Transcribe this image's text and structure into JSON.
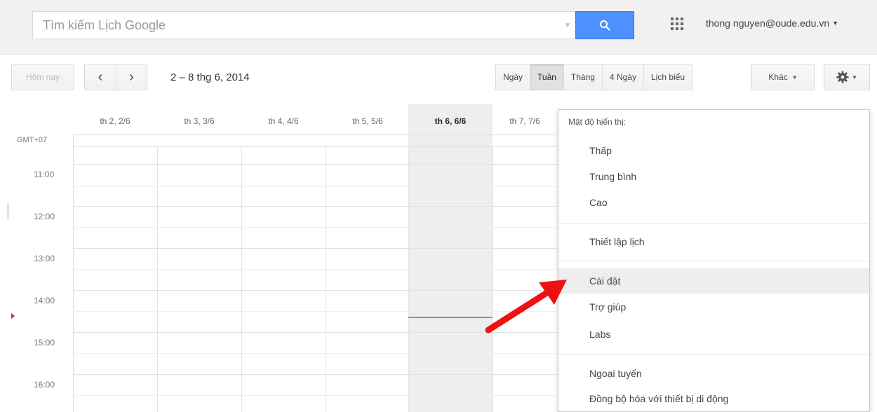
{
  "header": {
    "search_placeholder": "Tìm kiếm Lịch Google",
    "account": "thong nguyen@oude.edu.vn",
    "accent_color": "#4d90fe"
  },
  "toolbar": {
    "today": "Hôm nay",
    "prev": "‹",
    "next": "›",
    "date_range": "2 – 8 thg 6, 2014",
    "views": [
      "Ngày",
      "Tuần",
      "Tháng",
      "4 Ngày",
      "Lịch biểu"
    ],
    "active_view": "Tuần",
    "more": "Khác",
    "settings_icon": "gear-icon"
  },
  "calendar": {
    "timezone": "GMT+07",
    "days": [
      "th 2, 2/6",
      "th 3, 3/6",
      "th 4, 4/6",
      "th 5, 5/6",
      "th 6, 6/6",
      "th 7, 7/6"
    ],
    "today_index": 4,
    "hours": [
      "11:00",
      "12:00",
      "13:00",
      "14:00",
      "15:00",
      "16:00"
    ],
    "now_line_color": "#e76f60"
  },
  "settings_menu": {
    "density_label": "Mật độ hiển thị:",
    "density_options": [
      "Thấp",
      "Trung bình",
      "Cao"
    ],
    "calendar_settings": "Thiết lập lịch",
    "settings": "Cài đặt",
    "help": "Trợ giúp",
    "labs": "Labs",
    "offline": "Ngoại tuyến",
    "mobile_sync": "Đồng bộ hóa với thiết bị di động",
    "highlighted": "Cài đặt"
  }
}
